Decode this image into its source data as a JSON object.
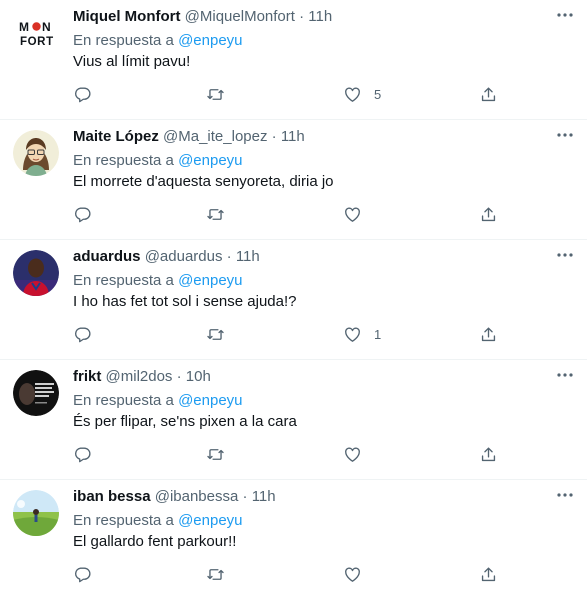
{
  "reply_prefix": "En respuesta a",
  "tweets": [
    {
      "name": "Miquel Monfort",
      "handle": "@MiquelMonfort",
      "time": "11h",
      "reply_to": "@enpeyu",
      "text": "Vius al límit pavu!",
      "replies": "",
      "retweets": "",
      "likes": "5",
      "avatar": {
        "kind": "logo",
        "top": "M",
        "mid": "N",
        "bottom": "FORT",
        "accent": "#d93025"
      }
    },
    {
      "name": "Maite López",
      "handle": "@Ma_ite_lopez",
      "time": "11h",
      "reply_to": "@enpeyu",
      "text": "El morrete d'aquesta senyoreta, diria jo",
      "replies": "",
      "retweets": "",
      "likes": "",
      "avatar": {
        "kind": "illustration",
        "bg": "#f1eed9"
      }
    },
    {
      "name": "aduardus",
      "handle": "@aduardus",
      "time": "11h",
      "reply_to": "@enpeyu",
      "text": "I ho has fet tot sol i sense ajuda!?",
      "replies": "",
      "retweets": "",
      "likes": "1",
      "avatar": {
        "kind": "photo",
        "bg": "#2b2f6b"
      }
    },
    {
      "name": "frikt",
      "handle": "@mil2dos",
      "time": "10h",
      "reply_to": "@enpeyu",
      "text": "És per flipar, se'ns pixen a la cara",
      "replies": "",
      "retweets": "",
      "likes": "",
      "avatar": {
        "kind": "poster",
        "bg": "#111111"
      }
    },
    {
      "name": "iban bessa",
      "handle": "@ibanbessa",
      "time": "11h",
      "reply_to": "@enpeyu",
      "text": "El gallardo fent parkour!!",
      "replies": "",
      "retweets": "",
      "likes": "",
      "avatar": {
        "kind": "landscape",
        "bg": "#8fc24a"
      }
    }
  ],
  "colors": {
    "text": "#0f1419",
    "muted": "#536471",
    "link": "#1d9bf0",
    "divider": "#eff3f4"
  },
  "icons": [
    "more-icon",
    "reply-icon",
    "retweet-icon",
    "like-icon",
    "share-icon"
  ]
}
